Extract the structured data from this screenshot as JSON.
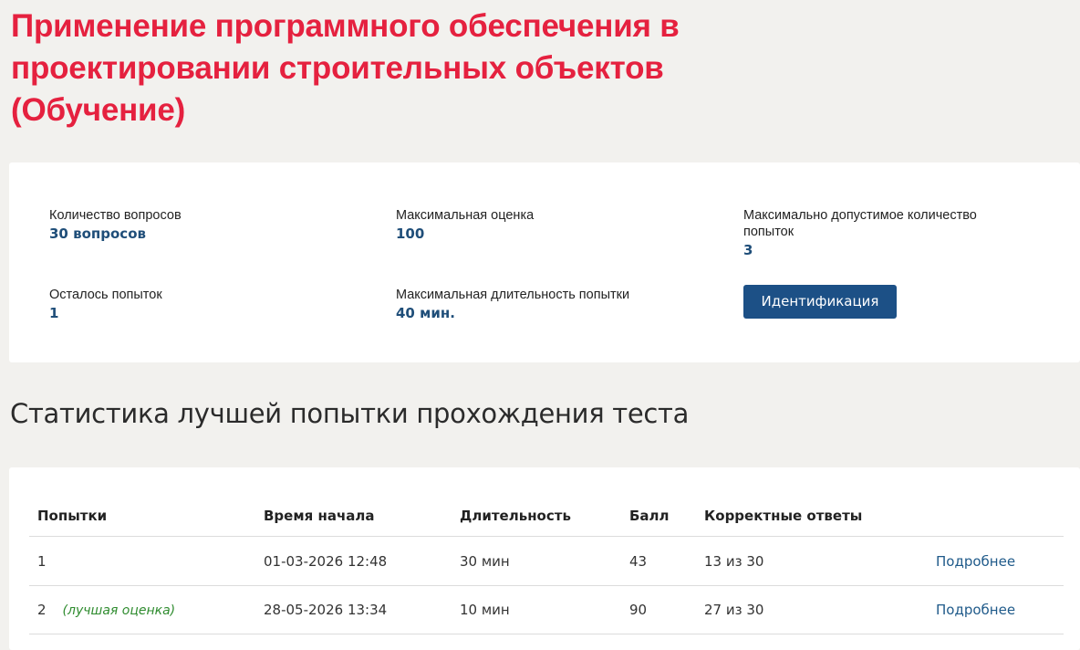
{
  "title": "Применение программного обеспечения в проектировании строительных объектов (Обучение)",
  "info": {
    "questions_label": "Количество вопросов",
    "questions_value": "30 вопросов",
    "max_score_label": "Максимальная оценка",
    "max_score_value": "100",
    "max_attempts_label": "Максимально допустимое количество попыток",
    "max_attempts_value": "3",
    "remaining_label": "Осталось попыток",
    "remaining_value": "1",
    "max_duration_label": "Максимальная длительность попытки",
    "max_duration_value": "40 мин.",
    "ident_button": "Идентификация"
  },
  "stats": {
    "section_title": "Статистика лучшей попытки прохождения теста",
    "columns": {
      "attempts": "Попытки",
      "start_time": "Время начала",
      "duration": "Длительность",
      "score": "Балл",
      "correct": "Корректные ответы"
    },
    "rows": [
      {
        "attempt": "1",
        "best_label": "",
        "start_time": "01-03-2026 12:48",
        "duration": "30 мин",
        "score": "43",
        "correct": "13 из 30",
        "details": "Подробнее"
      },
      {
        "attempt": "2",
        "best_label": "(лучшая оценка)",
        "start_time": "28-05-2026 13:34",
        "duration": "10 мин",
        "score": "90",
        "correct": "27 из 30",
        "details": "Подробнее"
      }
    ]
  },
  "colors": {
    "title": "#e5213f",
    "value": "#1f4e79",
    "button": "#1c5086",
    "best_label": "#2e8b2e",
    "link": "#1f5a8a",
    "background": "#f2f1ee"
  }
}
